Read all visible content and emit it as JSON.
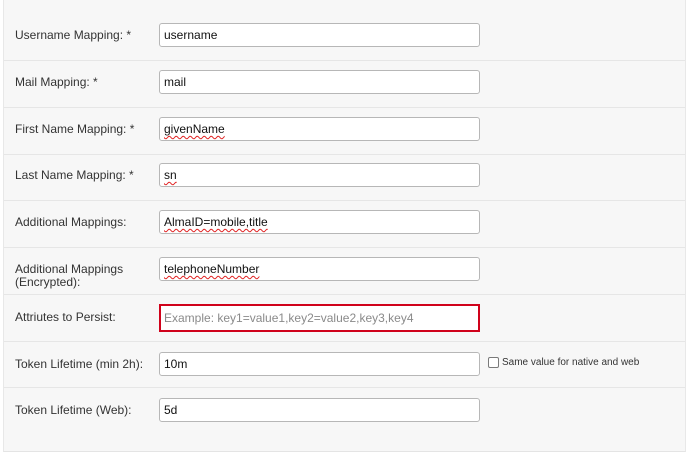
{
  "form": {
    "username": {
      "label": "Username Mapping: *",
      "value": "username"
    },
    "mail": {
      "label": "Mail Mapping: *",
      "value": "mail"
    },
    "first_name": {
      "label": "First Name Mapping: *",
      "value": "givenName"
    },
    "last_name": {
      "label": "Last Name Mapping: *",
      "value": "sn"
    },
    "additional": {
      "label": "Additional Mappings:",
      "value": "AlmaID=mobile,title"
    },
    "additional_encrypted": {
      "label": "Additional Mappings\n(Encrypted):",
      "value": "telephoneNumber"
    },
    "persist": {
      "label": "Attriutes to Persist:",
      "value": "",
      "placeholder": "Example: key1=value1,key2=value2,key3,key4"
    },
    "token_native": {
      "label": "Token Lifetime (min 2h):",
      "value": "10m",
      "checkbox_label": "Same value for native and web"
    },
    "token_web": {
      "label": "Token Lifetime (Web):",
      "value": "5d"
    }
  },
  "colors": {
    "error_border": "#d0021b",
    "panel_bg": "#f7f7f7"
  }
}
